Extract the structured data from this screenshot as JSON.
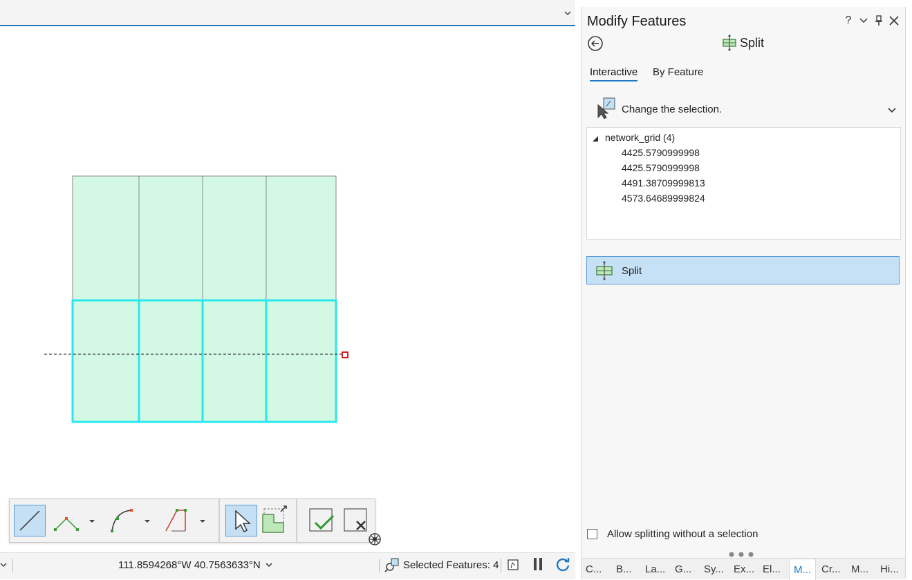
{
  "map": {
    "coordinates": "111.8594268°W 40.7563633°N",
    "selected_features": "Selected Features: 4"
  },
  "pane": {
    "title": "Modify Features",
    "controls": {
      "help": "?"
    },
    "tool_title": "Split",
    "tabs": [
      {
        "label": "Interactive",
        "active": true
      },
      {
        "label": "By Feature",
        "active": false
      }
    ],
    "selection_prompt": "Change the selection.",
    "tree": {
      "layer": "network_grid (4)",
      "items": [
        "4425.5790999998",
        "4425.5790999998",
        "4491.38709999813",
        "4573.64689999824"
      ]
    },
    "split_button": "Split",
    "allow_checkbox": {
      "label": "Allow splitting without a selection",
      "checked": false
    },
    "bottom_tabs": [
      "C...",
      "B...",
      "La...",
      "G...",
      "Sy...",
      "Ex...",
      "El...",
      "M...",
      "Cr...",
      "M...",
      "Hi..."
    ],
    "active_bottom_tab": 7
  },
  "colors": {
    "accent": "#1f78c1",
    "polygon_fill": "#d3f9e4",
    "selection_outline": "#28e8ec",
    "highlight": "#c6e0f5"
  }
}
